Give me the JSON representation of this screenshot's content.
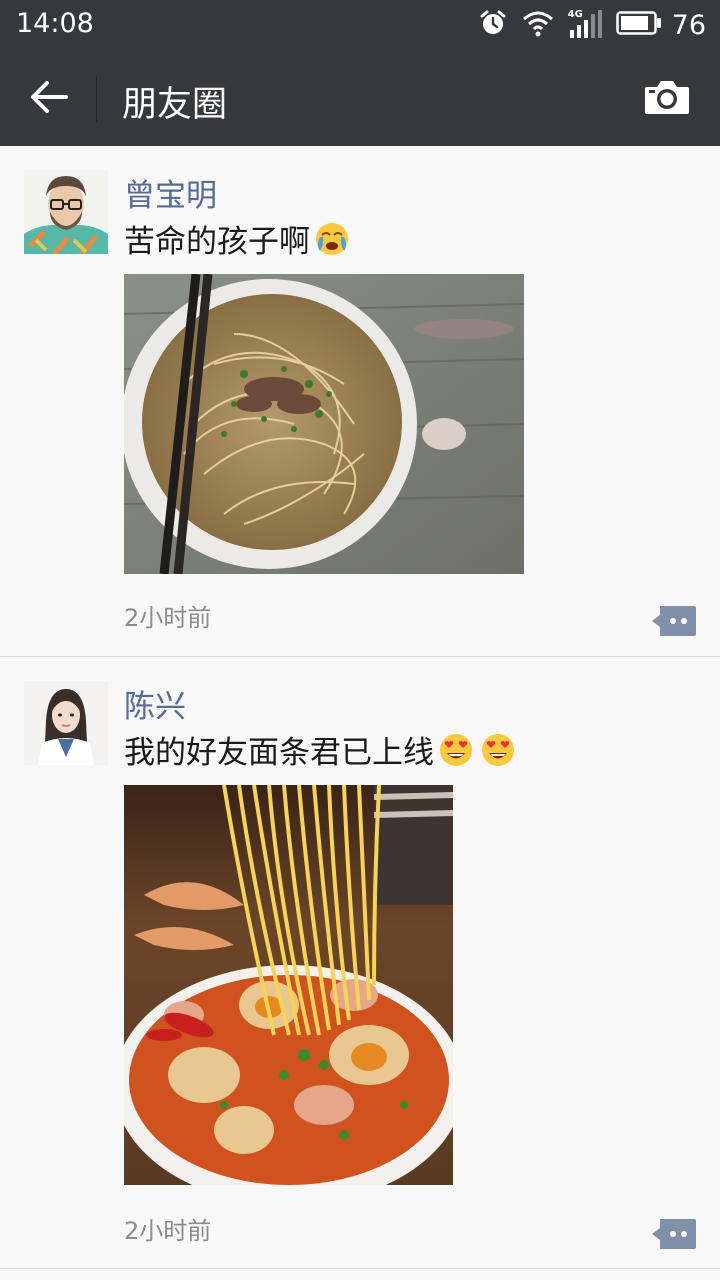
{
  "status_bar": {
    "time": "14:08",
    "network": "4G",
    "battery": "76",
    "icons": [
      "alarm-icon",
      "wifi-icon",
      "signal-icon",
      "battery-icon"
    ]
  },
  "nav": {
    "title": "朋友圈",
    "back_icon": "arrow-left-icon",
    "camera_icon": "camera-icon"
  },
  "colors": {
    "bar_bg": "#37383c",
    "name_link": "#576b95",
    "feed_bg": "#f8f8f8",
    "timestamp": "#8c8c8c"
  },
  "posts": [
    {
      "author": "曾宝明",
      "text": "苦命的孩子啊",
      "emoji": [
        "crying-face-emoji"
      ],
      "image": "beef-noodle-soup-photo",
      "time": "2小时前"
    },
    {
      "author": "陈兴",
      "text": "我的好友面条君已上线",
      "emoji": [
        "heart-eyes-emoji",
        "heart-eyes-emoji"
      ],
      "image": "tom-yum-noodle-photo",
      "time": "2小时前"
    }
  ]
}
